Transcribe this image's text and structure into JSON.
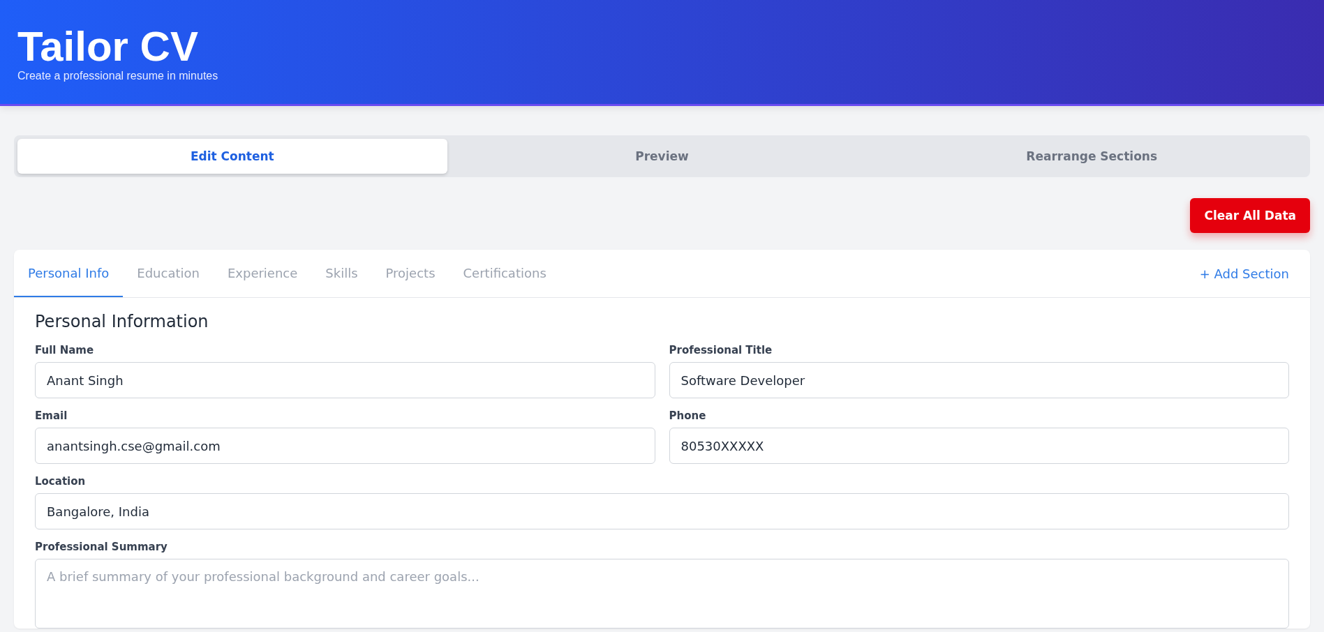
{
  "header": {
    "title": "Tailor CV",
    "subtitle": "Create a professional resume in minutes"
  },
  "mode_tabs": [
    {
      "label": "Edit Content",
      "selected": true
    },
    {
      "label": "Preview",
      "selected": false
    },
    {
      "label": "Rearrange Sections",
      "selected": false
    }
  ],
  "clear_button": "Clear All Data",
  "section_tabs": [
    {
      "label": "Personal Info",
      "selected": true
    },
    {
      "label": "Education",
      "selected": false
    },
    {
      "label": "Experience",
      "selected": false
    },
    {
      "label": "Skills",
      "selected": false
    },
    {
      "label": "Projects",
      "selected": false
    },
    {
      "label": "Certifications",
      "selected": false
    }
  ],
  "add_section": "+ Add Section",
  "form": {
    "heading": "Personal Information",
    "rows": [
      [
        {
          "kind": "text",
          "label": "Full Name",
          "value": "Anant Singh"
        },
        {
          "kind": "text",
          "label": "Professional Title",
          "value": "Software Developer"
        }
      ],
      [
        {
          "kind": "text",
          "label": "Email",
          "value": "anantsingh.cse@gmail.com"
        },
        {
          "kind": "text",
          "label": "Phone",
          "value": "80530XXXXX"
        }
      ],
      [
        {
          "kind": "text",
          "label": "Location",
          "value": "Bangalore, India"
        }
      ],
      [
        {
          "kind": "textarea",
          "label": "Professional Summary",
          "placeholder": "A brief summary of your professional background and career goals..."
        }
      ]
    ]
  }
}
